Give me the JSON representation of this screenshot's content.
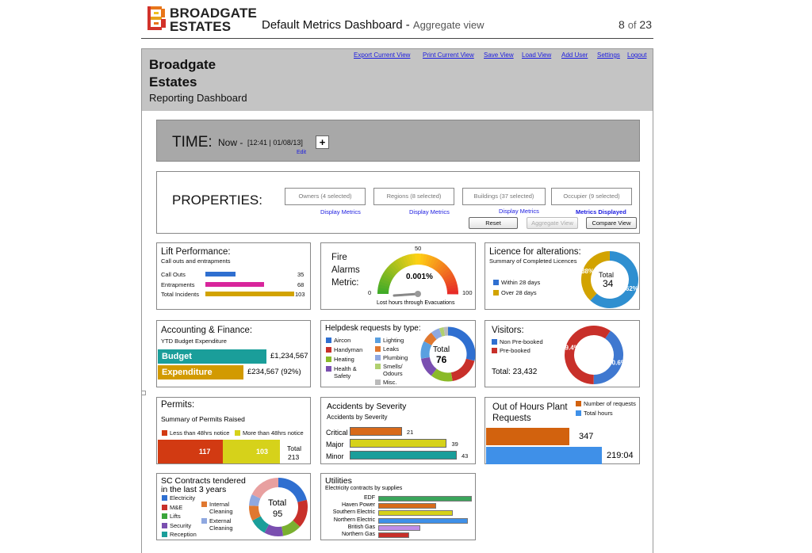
{
  "doc": {
    "brand_line1": "BROADGATE",
    "brand_line2": "ESTATES",
    "title": "Default Metrics Dashboard - ",
    "title_sub": "Aggregate view",
    "page_current": "8",
    "page_of": "of",
    "page_total": "23"
  },
  "app": {
    "name_line1": "Broadgate",
    "name_line2": "Estates",
    "subtitle": "Reporting Dashboard",
    "nav": [
      "Export Current View",
      "Print Current View",
      "Save View",
      "Load View",
      "Add User",
      "Settings",
      "Logout"
    ]
  },
  "time": {
    "label": "TIME:",
    "now": "Now -",
    "stamp": "[12:41 | 01/08/13]",
    "edit": "Edit",
    "plus": "+"
  },
  "properties": {
    "label": "PROPERTIES:",
    "selectors": [
      {
        "label": "Owners (4 selected)",
        "link": "Display Metrics"
      },
      {
        "label": "Regions (8 selected)",
        "link": "Display Metrics"
      },
      {
        "label": "Buildings (37 selected)",
        "link": "Display Metrics"
      },
      {
        "label": "Occupier (9 selected)",
        "link": "Metrics Displayed"
      }
    ],
    "reset": "Reset",
    "aggregate": "Aggregate View",
    "compare": "Compare View"
  },
  "colors": {
    "blue": "#2f6fd0",
    "magenta": "#d8259c",
    "gold": "#d2a300",
    "teal": "#1a9e9a",
    "orange_red": "#d23a12",
    "yellow": "#d6d21a",
    "green": "#3ba53b",
    "red": "#c8302a"
  },
  "lift": {
    "title": "Lift Performance:",
    "subtitle": "Call outs and entrapments",
    "rows": [
      {
        "label": "Call Outs",
        "value": "35",
        "num": 35,
        "color": "#2f6fd0"
      },
      {
        "label": "Entrapments",
        "value": "68",
        "num": 68,
        "color": "#d8259c"
      },
      {
        "label": "Total Incidents",
        "value": "103",
        "num": 103,
        "color": "#d2a300"
      }
    ]
  },
  "fire": {
    "title_lines": [
      "Fire",
      "Alarms",
      "Metric:"
    ],
    "value": "0.001%",
    "value_num": 0.001,
    "min": "0",
    "mid": "50",
    "max": "100",
    "caption": "Lost hours through Evacuations"
  },
  "licence": {
    "title": "Licence for alterations:",
    "subtitle": "Summary of Completed Licences",
    "legend": [
      {
        "label": "Within 28 days",
        "color": "#2f6fd0"
      },
      {
        "label": "Over 28 days",
        "color": "#d2a300"
      }
    ],
    "total_label": "Total",
    "total": "34",
    "slices": [
      {
        "pct": "62%",
        "value": 62,
        "color": "#2f8fd0"
      },
      {
        "pct": "38%",
        "value": 38,
        "color": "#d2a300"
      }
    ]
  },
  "accounting": {
    "title": "Accounting & Finance:",
    "subtitle": "YTD Budget Expenditure",
    "rows": [
      {
        "label": "Budget",
        "value": "£1,234,567",
        "num": 1234567,
        "color": "#1a9e9a"
      },
      {
        "label": "Expenditure",
        "value": "£234,567 (92%)",
        "num": 234567,
        "color": "#d29a00"
      }
    ]
  },
  "helpdesk": {
    "title": "Helpdesk requests by type:",
    "legend_left": [
      {
        "label": "Aircon",
        "color": "#2f6fd0"
      },
      {
        "label": "Handyman",
        "color": "#c8302a"
      },
      {
        "label": "Heating",
        "color": "#8aba28"
      },
      {
        "label": "Health &",
        "label2": "Safety",
        "color": "#7a4fb0"
      }
    ],
    "legend_right": [
      {
        "label": "Lighting",
        "color": "#5aa0e0"
      },
      {
        "label": "Leaks",
        "color": "#e07830"
      },
      {
        "label": "Plumbing",
        "color": "#8fa8e0"
      },
      {
        "label": "Smells/",
        "label2": "Odours",
        "color": "#b0d070"
      },
      {
        "label": "Misc.",
        "color": "#bbbbbb"
      }
    ],
    "total_label": "Total",
    "total": "76",
    "slices": [
      {
        "value": 22,
        "color": "#2f6fd0"
      },
      {
        "value": 14,
        "color": "#c8302a"
      },
      {
        "value": 10,
        "color": "#8aba28"
      },
      {
        "value": 9,
        "color": "#7a4fb0"
      },
      {
        "value": 8,
        "color": "#5aa0e0"
      },
      {
        "value": 5,
        "color": "#e07830"
      },
      {
        "value": 4,
        "color": "#8fa8e0"
      },
      {
        "value": 2,
        "color": "#b0d070"
      },
      {
        "value": 2,
        "color": "#bbbbbb"
      }
    ]
  },
  "visitors": {
    "title": "Visitors:",
    "legend": [
      {
        "label": "Non Pre-booked",
        "color": "#2f6fd0"
      },
      {
        "label": "Pre-booked",
        "color": "#c8302a"
      }
    ],
    "total": "Total: 23,432",
    "slices": [
      {
        "pct": "40.6%",
        "value": 40.6,
        "color": "#3f78d0"
      },
      {
        "pct": "59.4%",
        "value": 59.4,
        "color": "#c8302a"
      }
    ]
  },
  "permits": {
    "title": "Permits:",
    "subtitle": "Summary of Permits Raised",
    "legend": [
      {
        "label": "Less than 48hrs notice",
        "color": "#d23a12"
      },
      {
        "label": "More than 48hrs notice",
        "color": "#d6d21a"
      }
    ],
    "bars": [
      {
        "value": "117",
        "num": 117,
        "color": "#d23a12"
      },
      {
        "value": "103",
        "num": 103,
        "color": "#d6d21a"
      }
    ],
    "total_label": "Total",
    "total": "213"
  },
  "accidents": {
    "title": "Accidents by Severity",
    "subtitle": "Accidents by Severity",
    "rows": [
      {
        "label": "Critical",
        "value": "21",
        "num": 21,
        "color": "#d86a1a"
      },
      {
        "label": "Major",
        "value": "39",
        "num": 39,
        "color": "#d6d21a"
      },
      {
        "label": "Minor",
        "value": "43",
        "num": 43,
        "color": "#1a9e9a"
      }
    ]
  },
  "plant": {
    "title_lines": [
      "Out of Hours Plant",
      "Requests"
    ],
    "legend": [
      {
        "label": "Number of requests",
        "color": "#d2620e"
      },
      {
        "label": "Total hours",
        "color": "#3f90e8"
      }
    ],
    "bars": [
      {
        "value": "347",
        "num": 347,
        "color": "#d2620e"
      },
      {
        "value": "219:04",
        "num": 219.07,
        "color": "#3f90e8"
      }
    ]
  },
  "contracts": {
    "title_lines": [
      "SC Contracts tendered",
      "in the last 3 years"
    ],
    "legend_left": [
      {
        "label": "Electricity",
        "color": "#2f6fd0"
      },
      {
        "label": "M&E",
        "color": "#c8302a"
      },
      {
        "label": "Lifts",
        "color": "#3ba53b"
      },
      {
        "label": "Security",
        "color": "#7a4fb0"
      },
      {
        "label": "Reception",
        "color": "#1a9e9a"
      }
    ],
    "legend_right": [
      {
        "label": "Internal",
        "label2": "Cleaning",
        "color": "#e07830"
      },
      {
        "label": "External",
        "label2": "Cleaning",
        "color": "#8fa8e0"
      }
    ],
    "total_label": "Total",
    "total": "95",
    "slices": [
      {
        "value": 20,
        "color": "#2f6fd0"
      },
      {
        "value": 15,
        "color": "#c8302a"
      },
      {
        "value": 10,
        "color": "#7ab030"
      },
      {
        "value": 10,
        "color": "#7a4fb0"
      },
      {
        "value": 9,
        "color": "#1a9e9a"
      },
      {
        "value": 8,
        "color": "#e07830"
      },
      {
        "value": 6,
        "color": "#8fa8e0"
      },
      {
        "value": 17,
        "color": "#e8a0a0"
      }
    ]
  },
  "utilities": {
    "title": "Utilities",
    "subtitle": "Electricity contracts by supplies",
    "rows": [
      {
        "label": "EDF",
        "num": 100,
        "color": "#3ba55b"
      },
      {
        "label": "Haven Power",
        "num": 62,
        "color": "#d86a1a"
      },
      {
        "label": "Southern Electric",
        "num": 80,
        "color": "#d6d21a"
      },
      {
        "label": "Northern Electric",
        "num": 96,
        "color": "#3f90e8"
      },
      {
        "label": "British Gas",
        "num": 45,
        "color": "#c08ee8"
      },
      {
        "label": "Northern Gas",
        "num": 33,
        "color": "#c8302a"
      }
    ]
  }
}
